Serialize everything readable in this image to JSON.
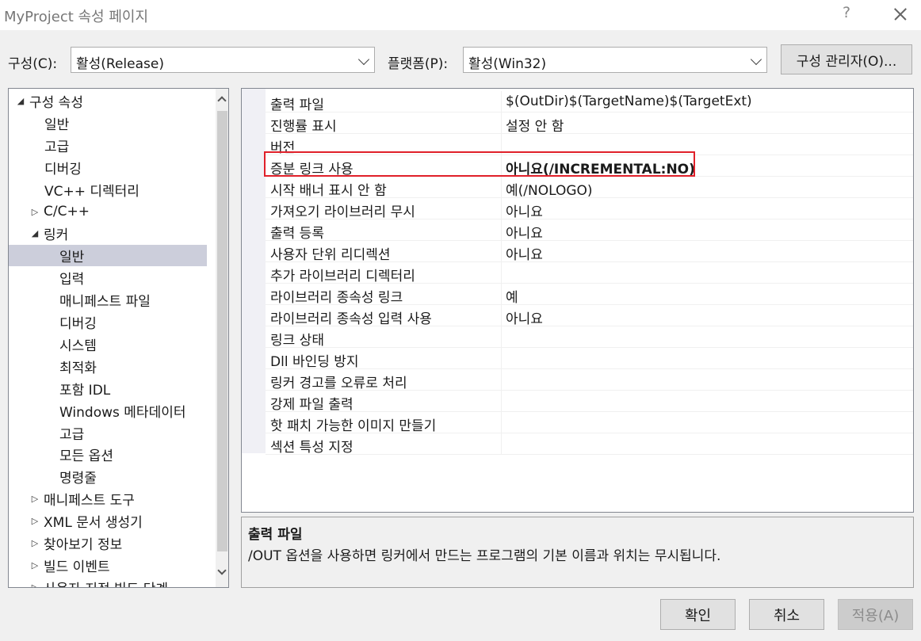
{
  "window": {
    "title": "MyProject 속성 페이지",
    "help": "?"
  },
  "toolbar": {
    "config_label": "구성(C):",
    "config_value": "활성(Release)",
    "platform_label": "플랫폼(P):",
    "platform_value": "활성(Win32)",
    "config_manager": "구성 관리자(O)..."
  },
  "tree": {
    "items": [
      {
        "label": "구성 속성",
        "expander": "◢"
      },
      {
        "label": "일반",
        "expander": ""
      },
      {
        "label": "고급",
        "expander": ""
      },
      {
        "label": "디버깅",
        "expander": ""
      },
      {
        "label": "VC++ 디렉터리",
        "expander": ""
      },
      {
        "label": "C/C++",
        "expander": "▷"
      },
      {
        "label": "링커",
        "expander": "◢"
      },
      {
        "label": "일반",
        "expander": "",
        "selected": true
      },
      {
        "label": "입력",
        "expander": ""
      },
      {
        "label": "매니페스트 파일",
        "expander": ""
      },
      {
        "label": "디버깅",
        "expander": ""
      },
      {
        "label": "시스템",
        "expander": ""
      },
      {
        "label": "최적화",
        "expander": ""
      },
      {
        "label": "포함 IDL",
        "expander": ""
      },
      {
        "label": "Windows 메타데이터",
        "expander": ""
      },
      {
        "label": "고급",
        "expander": ""
      },
      {
        "label": "모든 옵션",
        "expander": ""
      },
      {
        "label": "명령줄",
        "expander": ""
      },
      {
        "label": "매니페스트 도구",
        "expander": "▷"
      },
      {
        "label": "XML 문서 생성기",
        "expander": "▷"
      },
      {
        "label": "찾아보기 정보",
        "expander": "▷"
      },
      {
        "label": "빌드 이벤트",
        "expander": "▷"
      },
      {
        "label": "사용자 지정 빌드 단계",
        "expander": "▷"
      }
    ]
  },
  "properties": [
    {
      "name": "출력 파일",
      "value": "$(OutDir)$(TargetName)$(TargetExt)"
    },
    {
      "name": "진행률 표시",
      "value": "설정 안 함"
    },
    {
      "name": "버전",
      "value": ""
    },
    {
      "name": "증분 링크 사용",
      "value": "아니요(/INCREMENTAL:NO)",
      "bold": true
    },
    {
      "name": "시작 배너 표시 안 함",
      "value": "예(/NOLOGO)"
    },
    {
      "name": "가져오기 라이브러리 무시",
      "value": "아니요"
    },
    {
      "name": "출력 등록",
      "value": "아니요"
    },
    {
      "name": "사용자 단위 리디렉션",
      "value": "아니요"
    },
    {
      "name": "추가 라이브러리 디렉터리",
      "value": ""
    },
    {
      "name": "라이브러리 종속성 링크",
      "value": "예"
    },
    {
      "name": "라이브러리 종속성 입력 사용",
      "value": "아니요"
    },
    {
      "name": "링크 상태",
      "value": ""
    },
    {
      "name": "Dll 바인딩 방지",
      "value": ""
    },
    {
      "name": "링커 경고를 오류로 처리",
      "value": ""
    },
    {
      "name": "강제 파일 출력",
      "value": ""
    },
    {
      "name": "핫 패치 가능한 이미지 만들기",
      "value": ""
    },
    {
      "name": "섹션 특성 지정",
      "value": ""
    }
  ],
  "description": {
    "title": "출력 파일",
    "text": "/OUT 옵션을 사용하면 링커에서 만드는 프로그램의 기본 이름과 위치는 무시됩니다."
  },
  "buttons": {
    "ok": "확인",
    "cancel": "취소",
    "apply": "적용(A)"
  },
  "colors": {
    "highlight": "#e0202a",
    "selected_bg": "#cccedb"
  }
}
